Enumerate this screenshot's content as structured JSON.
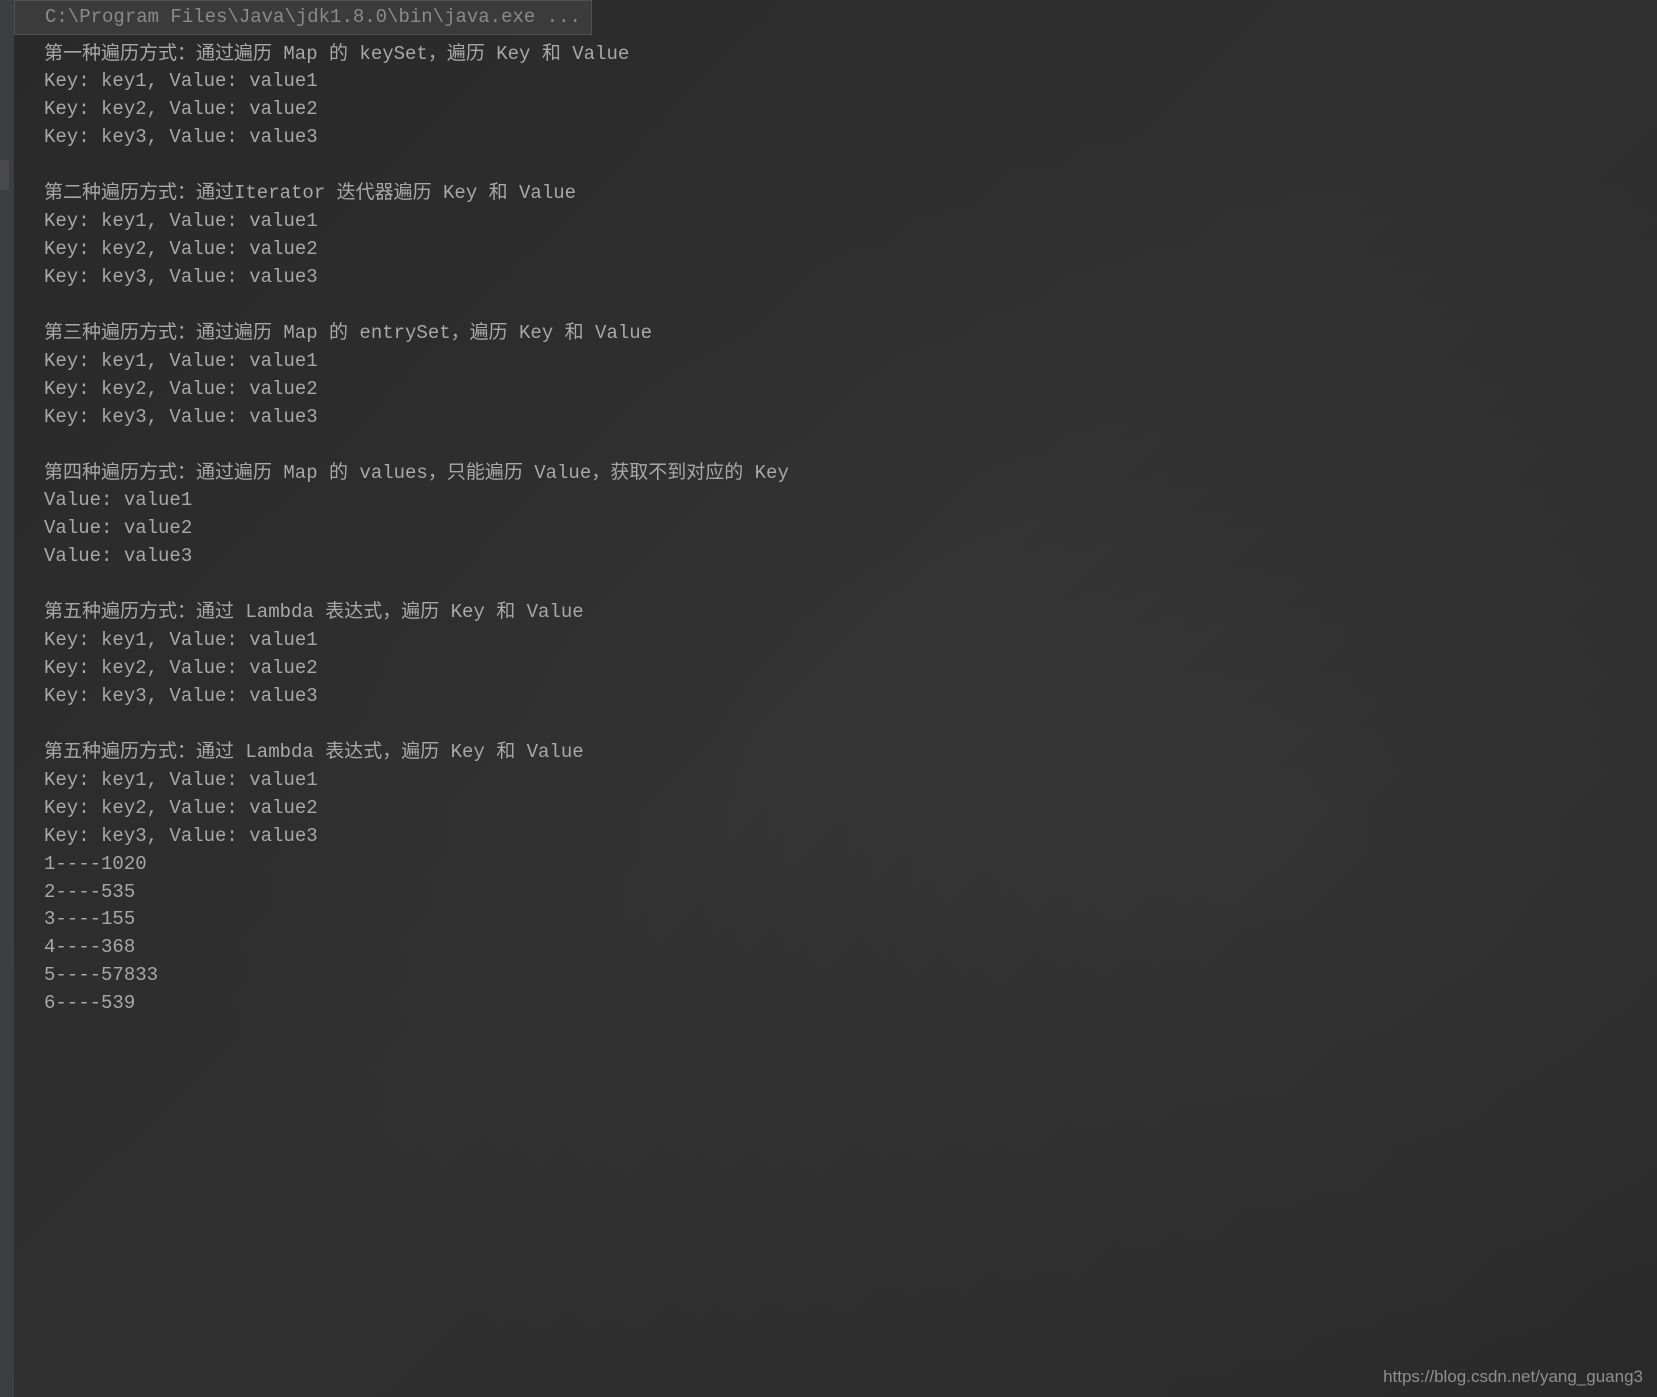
{
  "header": {
    "command": "C:\\Program Files\\Java\\jdk1.8.0\\bin\\java.exe  ..."
  },
  "output": {
    "section1": {
      "title": "第一种遍历方式：通过遍历 Map 的 keySet，遍历 Key 和 Value",
      "line1": "Key: key1, Value: value1",
      "line2": "Key: key2, Value: value2",
      "line3": "Key: key3, Value: value3"
    },
    "section2": {
      "title": "第二种遍历方式：通过Iterator 迭代器遍历 Key 和 Value",
      "line1": "Key: key1, Value: value1",
      "line2": "Key: key2, Value: value2",
      "line3": "Key: key3, Value: value3"
    },
    "section3": {
      "title": "第三种遍历方式：通过遍历 Map 的 entrySet，遍历 Key 和 Value",
      "line1": "Key: key1, Value: value1",
      "line2": "Key: key2, Value: value2",
      "line3": "Key: key3, Value: value3"
    },
    "section4": {
      "title": "第四种遍历方式：通过遍历 Map 的 values，只能遍历 Value，获取不到对应的 Key",
      "line1": "Value: value1",
      "line2": "Value: value2",
      "line3": "Value: value3"
    },
    "section5": {
      "title": "第五种遍历方式：通过 Lambda 表达式，遍历 Key 和 Value",
      "line1": "Key: key1, Value: value1",
      "line2": "Key: key2, Value: value2",
      "line3": "Key: key3, Value: value3"
    },
    "section6": {
      "title": "第五种遍历方式：通过 Lambda 表达式，遍历 Key 和 Value",
      "line1": "Key: key1, Value: value1",
      "line2": "Key: key2, Value: value2",
      "line3": "Key: key3, Value: value3"
    },
    "timings": {
      "t1": "1----1020",
      "t2": "2----535",
      "t3": "3----155",
      "t4": "4----368",
      "t5": "5----57833",
      "t6": "6----539"
    }
  },
  "watermark": "https://blog.csdn.net/yang_guang3"
}
